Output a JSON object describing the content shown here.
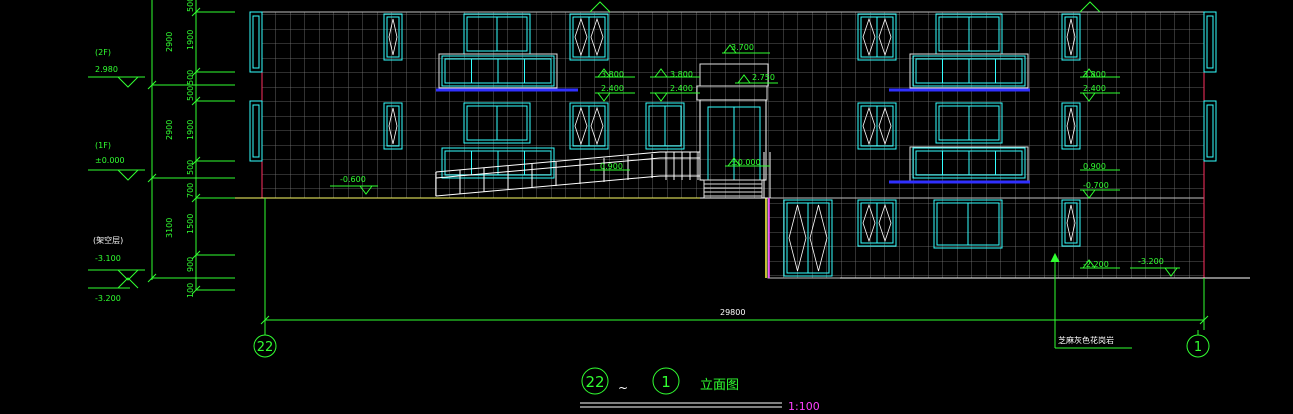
{
  "levels": {
    "f2_label": "(2F)",
    "f2_elev": "2.980",
    "f1_label": "(1F)",
    "f1_elev": "±0.000",
    "basement_label": "(架空层)",
    "basement_elev": "-3.100",
    "bottom_elev": "-3.200"
  },
  "dims": {
    "d500_top": "500",
    "d2900_upper": "2900",
    "d1900_upper": "1900",
    "d500_a": "500",
    "d500_b": "500",
    "d2900_lower": "2900",
    "d1900_lower": "1900",
    "d500_c": "500",
    "d700": "700",
    "d3100": "3100",
    "d1500": "1500",
    "d900": "900",
    "d100": "100",
    "total_width": "29800"
  },
  "elevations": {
    "e3700": "3.700",
    "e3800_l": "3.800",
    "e2400_l": "2.400",
    "e3800_m": "3.800",
    "e2400_m": "2.400",
    "e2750": "2.750",
    "e3800_r": "3.800",
    "e2400_r": "2.400",
    "em0600": "-0.600",
    "e0900_ramp": "0.900",
    "e0000_door": "±0.000",
    "e0900_r": "0.900",
    "em0700": "-0.700",
    "em2200": "-2.200",
    "em3200_r": "-3.200"
  },
  "axes": {
    "left": "22",
    "right": "1"
  },
  "notes": {
    "material": "芝麻灰色花岗岩"
  },
  "title": {
    "axis_from": "22",
    "tilde": "~",
    "axis_to": "1",
    "name": "立面图",
    "scale": "1:100"
  }
}
